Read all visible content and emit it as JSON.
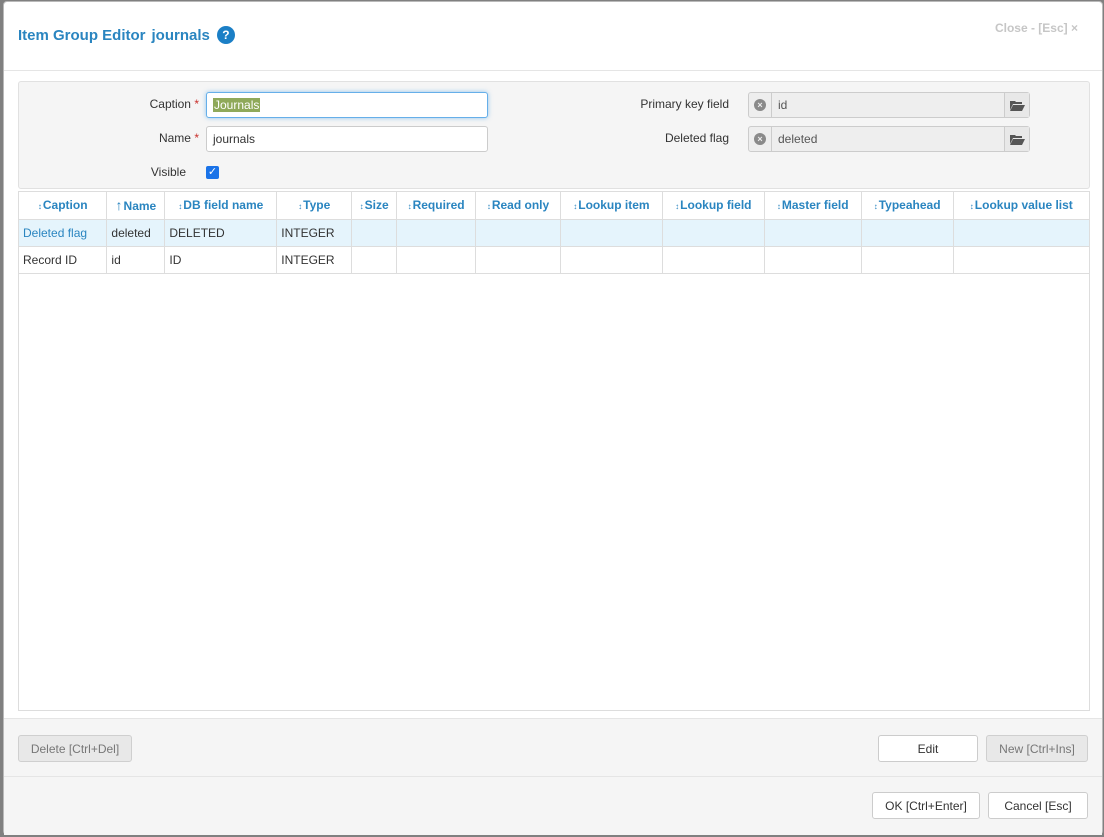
{
  "dialog": {
    "title": "Item Group Editor",
    "item_name": "journals",
    "help_icon": "?",
    "close_label": "Close - [Esc] ×"
  },
  "form": {
    "caption_label": "Caption",
    "caption_value": "Journals",
    "name_label": "Name",
    "name_value": "journals",
    "visible_label": "Visible",
    "visible_checked": true,
    "required_mark": "*",
    "primary_key_label": "Primary key field",
    "primary_key_value": "id",
    "deleted_flag_label": "Deleted flag",
    "deleted_flag_value": "deleted"
  },
  "grid": {
    "columns": [
      "Caption",
      "Name",
      "DB field name",
      "Type",
      "Size",
      "Required",
      "Read only",
      "Lookup item",
      "Lookup field",
      "Master field",
      "Typeahead",
      "Lookup value list"
    ],
    "sorted_column": "Name",
    "rows": [
      [
        "Deleted flag",
        "deleted",
        "DELETED",
        "INTEGER",
        "",
        "",
        "",
        "",
        "",
        "",
        "",
        ""
      ],
      [
        "Record ID",
        "id",
        "ID",
        "INTEGER",
        "",
        "",
        "",
        "",
        "",
        "",
        "",
        ""
      ]
    ],
    "selected_row": 0
  },
  "buttons": {
    "delete": "Delete [Ctrl+Del]",
    "edit": "Edit",
    "new": "New [Ctrl+Ins]",
    "ok": "OK [Ctrl+Enter]",
    "cancel": "Cancel [Esc]"
  },
  "colors": {
    "accent": "#2a85c0",
    "selected_row": "#e5f4fc",
    "required": "#c9302c"
  },
  "icons": {
    "help": "help-icon",
    "clear": "clear-icon",
    "folder": "folder-open-icon",
    "sort": "sort-icon",
    "sort_asc": "sort-ascending-icon",
    "checkbox": "checkmark-icon"
  }
}
